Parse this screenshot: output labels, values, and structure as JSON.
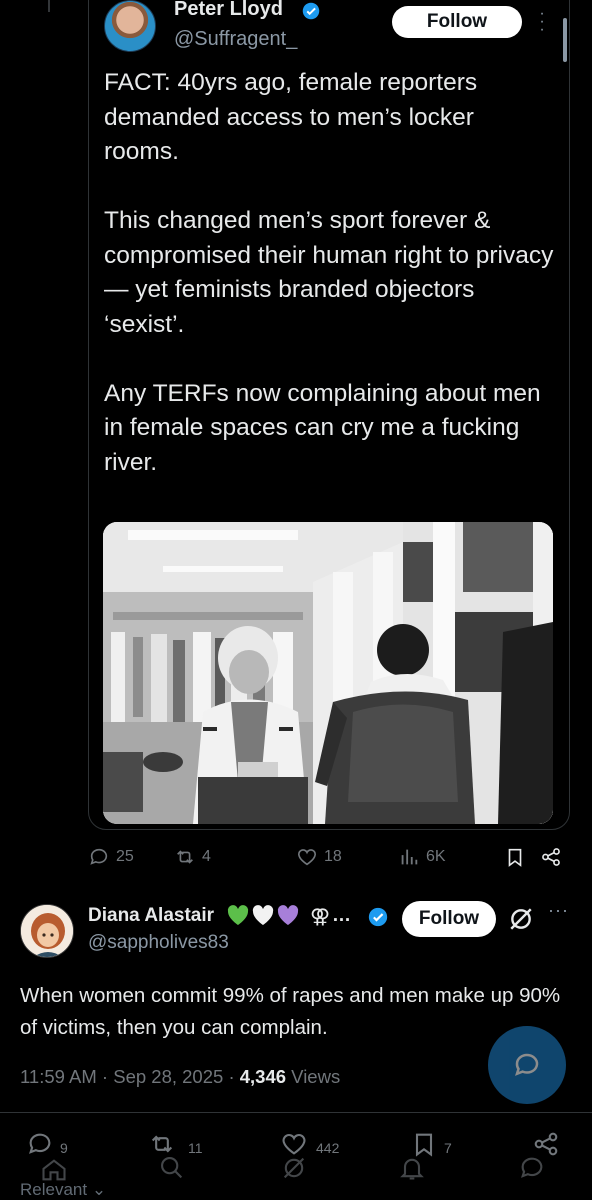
{
  "quoted_tweet": {
    "name": "Peter Lloyd",
    "handle": "@Suffragent_",
    "follow_label": "Follow",
    "text": "FACT: 40yrs ago, female reporters demanded access to men’s locker rooms.\n\nThis changed men’s sport forever & compromised their human right to privacy — yet feminists branded objectors ‘sexist’.\n\nAny TERFs now complaining about men in female spaces can cry me a fucking river.",
    "actions": {
      "replies": "25",
      "reposts": "4",
      "likes": "18",
      "views": "6K"
    }
  },
  "reply": {
    "name": "Diana Alastair",
    "name_suffix_symbol": "⚢",
    "name_ellipsis": "…",
    "handle": "@sappholives83",
    "follow_label": "Follow",
    "text": "When women commit 99% of rapes and men make up 90% of victims, then you can complain.",
    "time": "11:59 AM · Sep 28, 2025 · ",
    "views_count": "4,346",
    "views_label": " Views"
  },
  "bottom_actions": {
    "replies": "9",
    "reposts": "11",
    "likes": "442",
    "bookmarks": "7"
  },
  "bottom_nav": {
    "relevant_label": "Relevant"
  },
  "colors": {
    "accent_blue": "#1d9bf0",
    "heart_green": "#5cbf4a",
    "heart_white": "#f2f2f2",
    "heart_purple": "#a77fd9"
  },
  "icons": [
    "reply-icon",
    "repost-icon",
    "like-icon",
    "views-icon",
    "bookmark-icon",
    "share-icon",
    "grok-icon",
    "verified-icon",
    "compose-icon"
  ]
}
